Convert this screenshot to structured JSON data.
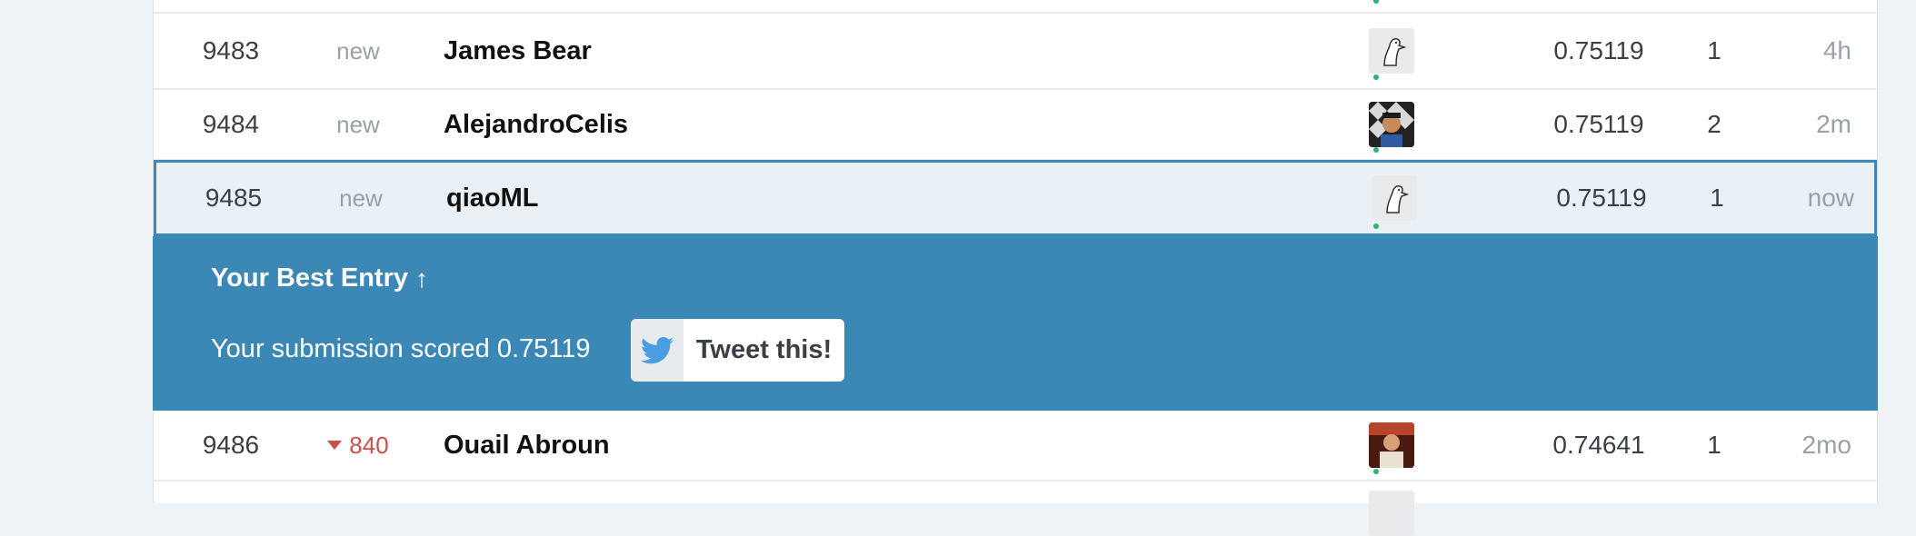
{
  "leaderboard": {
    "rows": [
      {
        "rank": "",
        "delta": "",
        "name": "",
        "score": "",
        "entries": "",
        "last": ""
      },
      {
        "rank": "9483",
        "delta": "new",
        "name": "James Bear",
        "score": "0.75119",
        "entries": "1",
        "last": "4h"
      },
      {
        "rank": "9484",
        "delta": "new",
        "name": "AlejandroCelis",
        "score": "0.75119",
        "entries": "2",
        "last": "2m"
      },
      {
        "rank": "9485",
        "delta": "new",
        "name": "qiaoML",
        "score": "0.75119",
        "entries": "1",
        "last": "now"
      },
      {
        "rank": "9486",
        "delta": "840",
        "name": "Ouail Abroun",
        "score": "0.74641",
        "entries": "1",
        "last": "2mo"
      }
    ]
  },
  "banner": {
    "title": "Your Best Entry",
    "arrow": "↑",
    "text": "Your submission scored 0.75119",
    "tweet_label": "Tweet this!"
  },
  "colors": {
    "banner": "#3b88b7",
    "self_row": "#e9f0f6",
    "rank_down": "#c8524a",
    "online_dot": "#2db56f",
    "twitter": "#4a9de0"
  },
  "icons": {
    "default_avatar": "duck-avatar-icon",
    "rank_change": "triangle-down-icon",
    "tweet": "twitter-bird-icon"
  }
}
